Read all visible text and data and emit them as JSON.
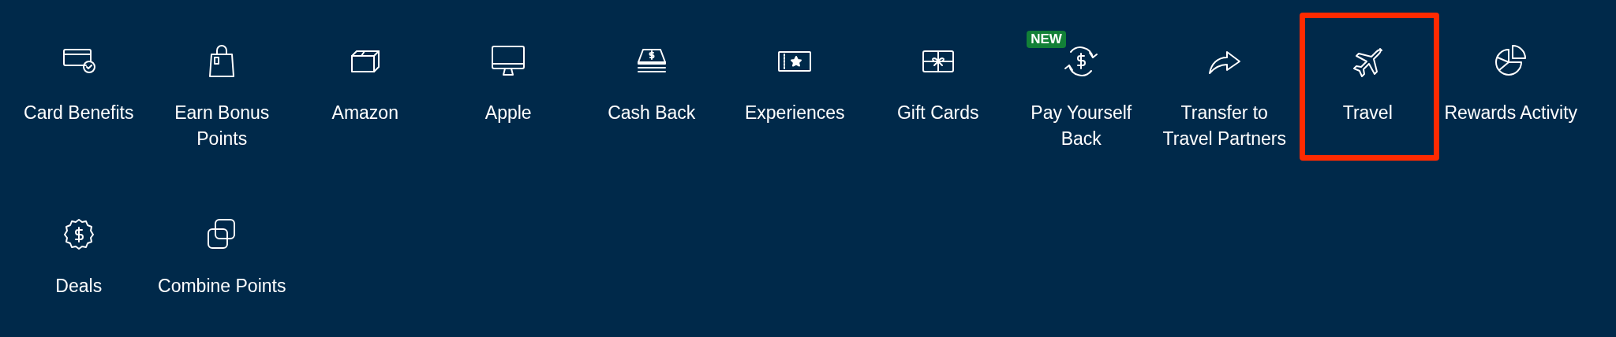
{
  "items": [
    {
      "label": "Card Benefits",
      "highlighted": false
    },
    {
      "label": "Earn Bonus Points",
      "highlighted": false
    },
    {
      "label": "Amazon",
      "highlighted": false
    },
    {
      "label": "Apple",
      "highlighted": false
    },
    {
      "label": "Cash Back",
      "highlighted": false
    },
    {
      "label": "Experiences",
      "highlighted": false
    },
    {
      "label": "Gift Cards",
      "highlighted": false
    },
    {
      "label": "Pay Yourself Back",
      "badge": "NEW",
      "highlighted": false
    },
    {
      "label": "Transfer to Travel Partners",
      "highlighted": false
    },
    {
      "label": "Travel",
      "highlighted": true
    },
    {
      "label": "Rewards Activity",
      "highlighted": false
    },
    {
      "label": "Deals",
      "highlighted": false
    },
    {
      "label": "Combine Points",
      "highlighted": false
    }
  ]
}
